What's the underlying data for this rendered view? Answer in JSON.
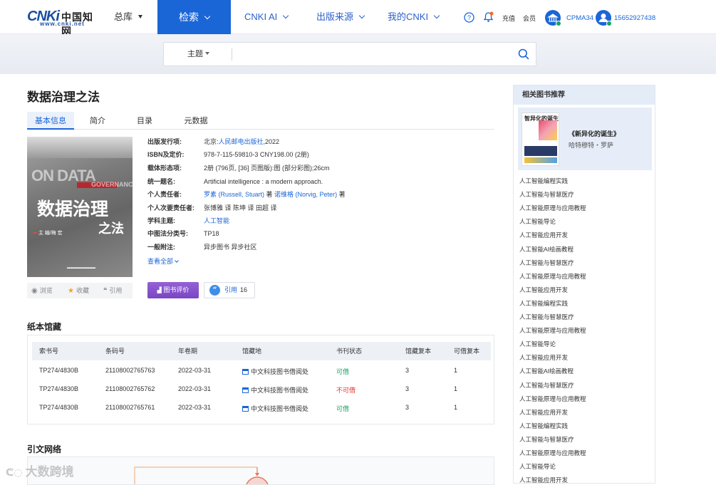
{
  "nav": {
    "logo_mark": "CNKi",
    "logo_cn": "中国知网",
    "logo_url": "www.cnki.net",
    "library": "总库",
    "search": "检索",
    "ai": "CNKI AI",
    "sources": "出版来源",
    "my": "我的CNKI",
    "recharge": "充值",
    "member": "会员",
    "org": "CPMA34",
    "user": "15652927438"
  },
  "search": {
    "scope": "主题",
    "value": ""
  },
  "book": {
    "title": "数据治理之法",
    "tabs": [
      "基本信息",
      "简介",
      "目录",
      "元数据"
    ],
    "cover": {
      "ondata": "ON DATA",
      "governance": "GOVERNANCE",
      "title_1": "数据治理",
      "title_2": "之法",
      "editor": "主 编/梅 宏"
    },
    "cover_actions": {
      "browse": "浏览",
      "collect": "收藏",
      "cite": "引用"
    },
    "fields": [
      {
        "label": "出版发行项:",
        "prefix": "北京:",
        "link": "人民邮电出版社",
        "suffix": ",2022"
      },
      {
        "label": "ISBN及定价:",
        "prefix": "978-7-115-59810-3 CNY198.00 (2册)",
        "link": "",
        "suffix": ""
      },
      {
        "label": "载体形态项:",
        "prefix": "2册 (796页, [36] 页图版):图 (部分彩图);26cm",
        "link": "",
        "suffix": ""
      },
      {
        "label": "统一题名:",
        "prefix": "Artificial intelligence : a modern approach.",
        "link": "",
        "suffix": ""
      },
      {
        "label": "个人责任者:",
        "prefix": "",
        "link": "罗素 (Russell, Stuart)",
        "suffix": " 著 ",
        "link2": "诺维格 (Norvig, Peter)",
        "suffix2": " 著"
      },
      {
        "label": "个人次要责任者:",
        "prefix": "张博雅 译 陈坤 译 田超 译",
        "link": "",
        "suffix": ""
      },
      {
        "label": "学科主题:",
        "prefix": "",
        "link": "人工智能",
        "suffix": ""
      },
      {
        "label": "中图法分类号:",
        "prefix": "TP18",
        "link": "",
        "suffix": ""
      },
      {
        "label": "一般附注:",
        "prefix": "异步图书 异步社区",
        "link": "",
        "suffix": ""
      }
    ],
    "more": "查看全部",
    "review_button": "图书评价",
    "cite_button": "引用",
    "cite_count": "16"
  },
  "holdings": {
    "heading": "纸本馆藏",
    "columns": [
      "索书号",
      "条码号",
      "年卷期",
      "馆藏地",
      "书刊状态",
      "馆藏复本",
      "可借复本"
    ],
    "rows": [
      [
        "TP274/4830B",
        "21108002765763",
        "2022-03-31",
        "中文科技图书借阅处",
        "可借",
        "3",
        "1"
      ],
      [
        "TP274/4830B",
        "21108002765762",
        "2022-03-31",
        "中文科技图书借阅处",
        "不可借",
        "3",
        "1"
      ],
      [
        "TP274/4830B",
        "21108002765761",
        "2022-03-31",
        "中文科技图书借阅处",
        "可借",
        "3",
        "1"
      ]
    ]
  },
  "citation_network": {
    "heading": "引文网络"
  },
  "related": {
    "heading": "相关图书推荐",
    "featured_cover": "智异化的诞生",
    "featured_title": "《新异化的诞生》",
    "featured_author": "哈特穆特・罗萨",
    "items": [
      "人工智能编程实践",
      "人工智能与智慧医疗",
      "人工智能原理与应用教程",
      "人工智能导论",
      "人工智能应用开发",
      "人工智能AI绘画教程",
      "人工智能与智慧医疗",
      "人工智能原理与应用教程",
      "人工智能应用开发",
      "人工智能编程实践",
      "人工智能与智慧医疗",
      "人工智能原理与应用教程",
      "人工智能导论",
      "人工智能应用开发",
      "人工智能AI绘画教程",
      "人工智能与智慧医疗",
      "人工智能原理与应用教程",
      "人工智能应用开发",
      "人工智能编程实践",
      "人工智能与智慧医疗",
      "人工智能原理与应用教程",
      "人工智能导论",
      "人工智能应用开发"
    ]
  },
  "watermark": "大数跨境",
  "colors": {
    "accent": "#1b66d6",
    "purple": "#8a55d0",
    "ok": "#1aa260",
    "no": "#e0332f"
  }
}
